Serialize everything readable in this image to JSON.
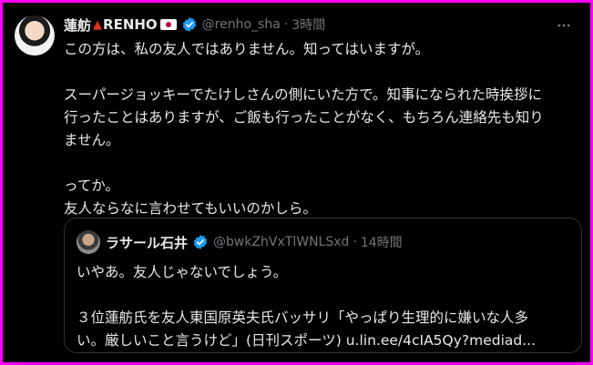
{
  "tweet": {
    "display_name": "蓮舫",
    "display_name_suffix": "RENHO",
    "handle": "@renho_sha",
    "separator": "·",
    "time": "3時間",
    "body": "この方は、私の友人ではありません。知ってはいますが。\n\nスーパージョッキーでたけしさんの側にいた方で。知事になられた時挨拶に\n行ったことはありますが、ご飯も行ったことがなく、もちろん連絡先も知り\nません。\n\nってか。\n友人ならなに言わせてもいいのかしら。",
    "more_icon": "more-dots-icon"
  },
  "quoted_tweet": {
    "display_name": "ラサール石井",
    "handle": "@bwkZhVxTlWNLSxd",
    "separator": "·",
    "time": "14時間",
    "body": "いやあ。友人じゃないでしょう。\n\n３位蓮舫氏を友人東国原英夫氏バッサリ「やっぱり生理的に嫌いな人多\nい。厳しいこと言うけど」(日刊スポーツ) u.lin.ee/4cIA5Qy?mediad..."
  },
  "colors": {
    "background": "#000000",
    "border_accent": "#ff00ff",
    "text_primary": "#e7e9ea",
    "text_secondary": "#71767b",
    "verified_blue": "#1d9bf0",
    "quote_border": "#2f3336"
  }
}
